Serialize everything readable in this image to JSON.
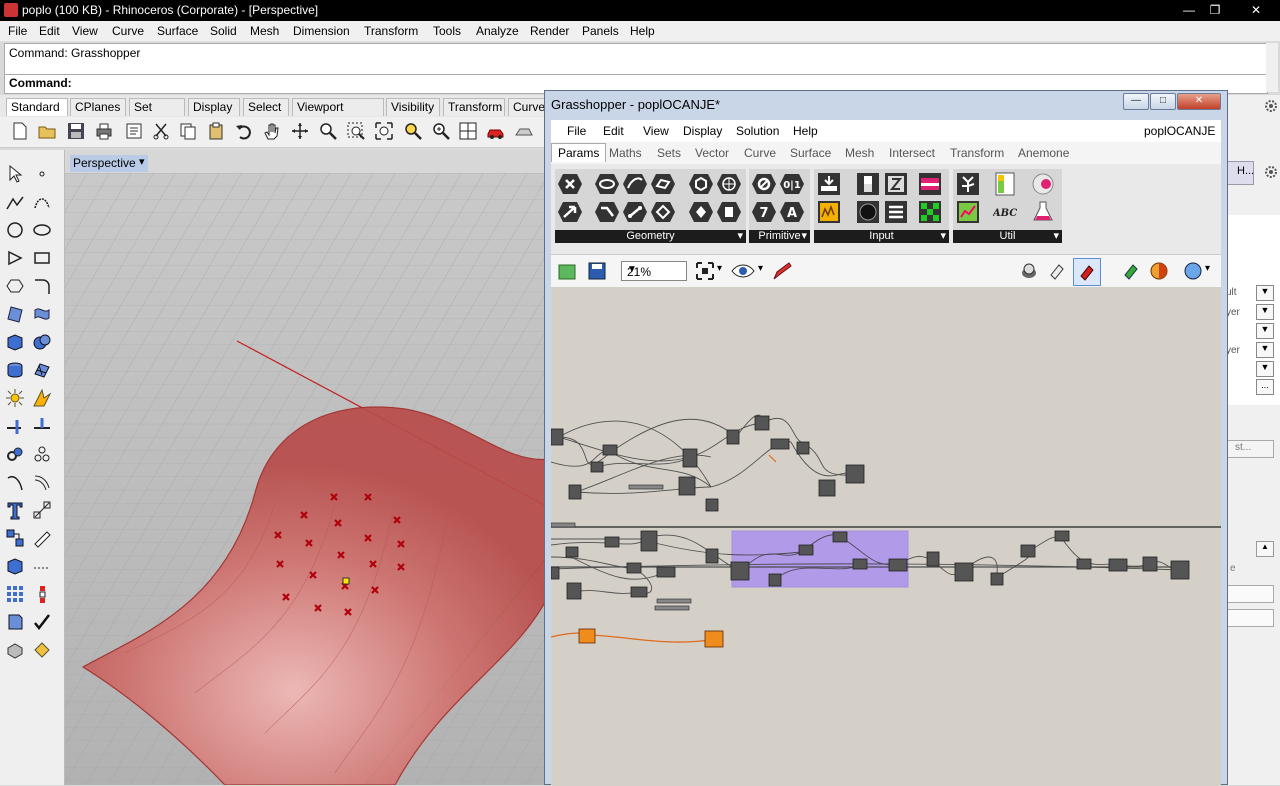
{
  "rhino": {
    "title": "poplo (100 KB) - Rhinoceros (Corporate) - [Perspective]",
    "menu": [
      "File",
      "Edit",
      "View",
      "Curve",
      "Surface",
      "Solid",
      "Mesh",
      "Dimension",
      "Transform",
      "Tools",
      "Analyze",
      "Render",
      "Panels",
      "Help"
    ],
    "command_history": "Command: Grasshopper",
    "command_prompt": "Command:",
    "toolbar_tabs": [
      "Standard",
      "CPlanes",
      "Set View",
      "Display",
      "Select",
      "Viewport Layout",
      "Visibility",
      "Transform",
      "Curve"
    ],
    "viewport_name": "Perspective",
    "panel_fragments": [
      "H...",
      "ult",
      "yer",
      "yer",
      "st...",
      "e",
      "..."
    ]
  },
  "grasshopper": {
    "title": "Grasshopper - poplOCANJE*",
    "doc_name": "poplOCANJE",
    "menu": [
      "File",
      "Edit",
      "View",
      "Display",
      "Solution",
      "Help"
    ],
    "tabs": [
      "Params",
      "Maths",
      "Sets",
      "Vector",
      "Curve",
      "Surface",
      "Mesh",
      "Intersect",
      "Transform",
      "Anemone"
    ],
    "groups": [
      "Geometry",
      "Primitive",
      "Input",
      "Util"
    ],
    "zoom": "21%",
    "primitive_glyphs": [
      "0|1",
      "7",
      "A"
    ],
    "util_glyph": "ABC"
  },
  "colors": {
    "accent": "#cc2222",
    "surface": "#c05050",
    "selection": "#a98ff0"
  }
}
